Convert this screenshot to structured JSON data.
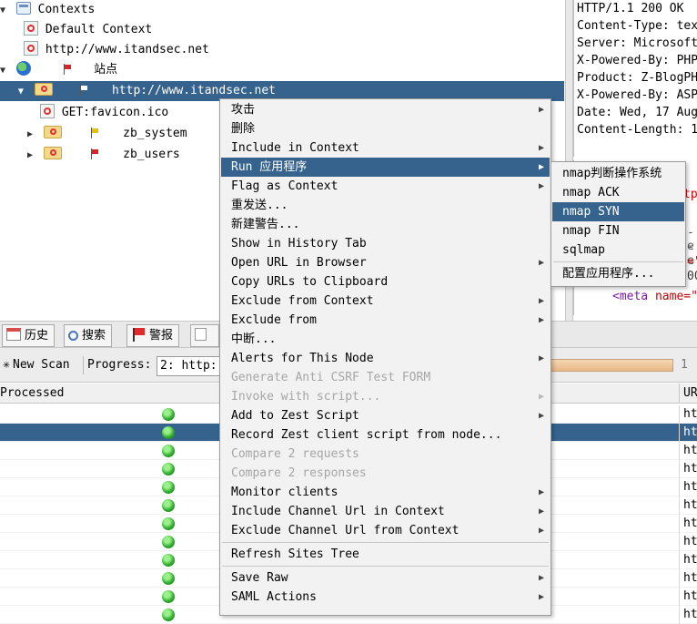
{
  "tree": {
    "contexts_label": "Contexts",
    "default_context": "Default Context",
    "context_url": "http://www.itandsec.net",
    "sites_label": "站点",
    "site_url": "http://www.itandsec.net",
    "favicon_node": "GET:favicon.ico",
    "folder_system": "zb_system",
    "folder_users": "zb_users"
  },
  "response": {
    "headers": [
      "HTTP/1.1 200 OK",
      "Content-Type: tex",
      "Server: Microsoft",
      "X-Powered-By: PHP",
      "Product: Z-BlogPH",
      "X-Powered-By: ASP",
      "Date: Wed, 17 Aug",
      "Content-Length: 1"
    ],
    "body_fragments": [
      "tp",
      "-e",
      "-e",
      "=\"",
      "000",
      "=\""
    ],
    "meta_tag": "<meta",
    "meta_attr": "name=\""
  },
  "tabs": [
    {
      "label": "历史",
      "icon": "calendar-icon"
    },
    {
      "label": "搜索",
      "icon": "search-icon"
    },
    {
      "label": "警报",
      "icon": "alert-flag-icon"
    },
    {
      "label": "",
      "icon": "document-icon"
    }
  ],
  "scan": {
    "new_scan_label": "New Scan",
    "progress_label": "Progress:",
    "progress_select": "2: http:",
    "progress_value": "1"
  },
  "table": {
    "header_processed": "Processed",
    "header_url": "UR",
    "rows": [
      {
        "url": "ht",
        "selected": false
      },
      {
        "url": "ht",
        "selected": true
      },
      {
        "url": "ht",
        "selected": false
      },
      {
        "url": "ht",
        "selected": false
      },
      {
        "url": "ht",
        "selected": false
      },
      {
        "url": "ht",
        "selected": false
      },
      {
        "url": "ht",
        "selected": false
      },
      {
        "url": "ht",
        "selected": false
      },
      {
        "url": "ht",
        "selected": false
      },
      {
        "url": "ht",
        "selected": false
      },
      {
        "url": "ht",
        "selected": false
      },
      {
        "url": "ht",
        "selected": false
      }
    ]
  },
  "context_menu": {
    "items": [
      {
        "label": "攻击",
        "submenu": true,
        "disabled": false
      },
      {
        "label": "删除",
        "submenu": false,
        "disabled": false
      },
      {
        "label": "Include in Context",
        "submenu": true,
        "disabled": false
      },
      {
        "label": "Run 应用程序",
        "submenu": true,
        "disabled": false,
        "highlighted": true
      },
      {
        "label": "Flag as Context",
        "submenu": true,
        "disabled": false
      },
      {
        "label": "重发送...",
        "submenu": false,
        "disabled": false
      },
      {
        "label": "新建警告...",
        "submenu": false,
        "disabled": false
      },
      {
        "label": "Show in History Tab",
        "submenu": false,
        "disabled": false
      },
      {
        "label": "Open URL in Browser",
        "submenu": true,
        "disabled": false
      },
      {
        "label": "Copy URLs to Clipboard",
        "submenu": false,
        "disabled": false
      },
      {
        "label": "Exclude from Context",
        "submenu": true,
        "disabled": false
      },
      {
        "label": "Exclude from",
        "submenu": true,
        "disabled": false
      },
      {
        "label": "中断...",
        "submenu": false,
        "disabled": false
      },
      {
        "label": "Alerts for This Node",
        "submenu": true,
        "disabled": false
      },
      {
        "label": "Generate Anti CSRF Test FORM",
        "submenu": false,
        "disabled": true
      },
      {
        "label": "Invoke with script...",
        "submenu": true,
        "disabled": true
      },
      {
        "label": "Add to Zest Script",
        "submenu": true,
        "disabled": false
      },
      {
        "label": "Record Zest client script from node...",
        "submenu": false,
        "disabled": false
      },
      {
        "label": "Compare 2 requests",
        "submenu": false,
        "disabled": true
      },
      {
        "label": "Compare 2 responses",
        "submenu": false,
        "disabled": true
      },
      {
        "label": "Monitor clients",
        "submenu": true,
        "disabled": false
      },
      {
        "label": "Include Channel Url in Context",
        "submenu": true,
        "disabled": false
      },
      {
        "label": "Exclude Channel Url from Context",
        "submenu": true,
        "disabled": false
      },
      {
        "label": "Refresh Sites Tree",
        "submenu": false,
        "disabled": false
      },
      {
        "label": "Save Raw",
        "submenu": true,
        "disabled": false
      },
      {
        "label": "SAML Actions",
        "submenu": true,
        "disabled": false
      }
    ]
  },
  "sub_menu": {
    "items": [
      {
        "label": "nmap判断操作系统"
      },
      {
        "label": "nmap ACK"
      },
      {
        "label": "nmap SYN",
        "highlighted": true
      },
      {
        "label": "nmap FIN"
      },
      {
        "label": "sqlmap"
      },
      {
        "label": "配置应用程序..."
      }
    ]
  },
  "colors": {
    "selection": "#35638e",
    "menu_bg": "#f2f2f2",
    "disabled_text": "#a6a6a6",
    "status_green": "#2aa82a"
  }
}
